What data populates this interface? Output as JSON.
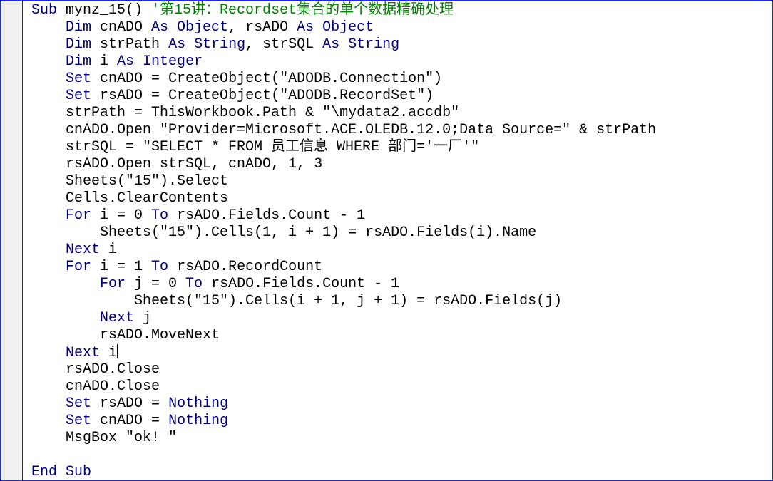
{
  "editor": {
    "colors": {
      "keyword": "#00007f",
      "comment": "#008000",
      "text": "#000000",
      "border": "#1f2bd6"
    },
    "caret_line": 20,
    "lines": [
      [
        [
          "k",
          "Sub"
        ],
        [
          "p",
          " mynz_15() "
        ],
        [
          "c",
          "'第15讲：Recordset集合的单个数据精确处理"
        ]
      ],
      [
        [
          "p",
          "    "
        ],
        [
          "k",
          "Dim"
        ],
        [
          "p",
          " cnADO "
        ],
        [
          "k",
          "As Object"
        ],
        [
          "p",
          ", rsADO "
        ],
        [
          "k",
          "As Object"
        ]
      ],
      [
        [
          "p",
          "    "
        ],
        [
          "k",
          "Dim"
        ],
        [
          "p",
          " strPath "
        ],
        [
          "k",
          "As String"
        ],
        [
          "p",
          ", strSQL "
        ],
        [
          "k",
          "As String"
        ]
      ],
      [
        [
          "p",
          "    "
        ],
        [
          "k",
          "Dim"
        ],
        [
          "p",
          " i "
        ],
        [
          "k",
          "As Integer"
        ]
      ],
      [
        [
          "p",
          "    "
        ],
        [
          "k",
          "Set"
        ],
        [
          "p",
          " cnADO = CreateObject(\"ADODB.Connection\")"
        ]
      ],
      [
        [
          "p",
          "    "
        ],
        [
          "k",
          "Set"
        ],
        [
          "p",
          " rsADO = CreateObject(\"ADODB.RecordSet\")"
        ]
      ],
      [
        [
          "p",
          "    strPath = ThisWorkbook.Path & \"\\mydata2.accdb\""
        ]
      ],
      [
        [
          "p",
          "    cnADO.Open \"Provider=Microsoft.ACE.OLEDB.12.0;Data Source=\" & strPath"
        ]
      ],
      [
        [
          "p",
          "    strSQL = \"SELECT * FROM 员工信息 WHERE 部门='一厂'\""
        ]
      ],
      [
        [
          "p",
          "    rsADO.Open strSQL, cnADO, 1, 3"
        ]
      ],
      [
        [
          "p",
          "    Sheets(\"15\").Select"
        ]
      ],
      [
        [
          "p",
          "    Cells.ClearContents"
        ]
      ],
      [
        [
          "p",
          "    "
        ],
        [
          "k",
          "For"
        ],
        [
          "p",
          " i = 0 "
        ],
        [
          "k",
          "To"
        ],
        [
          "p",
          " rsADO.Fields.Count - 1"
        ]
      ],
      [
        [
          "p",
          "        Sheets(\"15\").Cells(1, i + 1) = rsADO.Fields(i).Name"
        ]
      ],
      [
        [
          "p",
          "    "
        ],
        [
          "k",
          "Next"
        ],
        [
          "p",
          " i"
        ]
      ],
      [
        [
          "p",
          "    "
        ],
        [
          "k",
          "For"
        ],
        [
          "p",
          " i = 1 "
        ],
        [
          "k",
          "To"
        ],
        [
          "p",
          " rsADO.RecordCount"
        ]
      ],
      [
        [
          "p",
          "        "
        ],
        [
          "k",
          "For"
        ],
        [
          "p",
          " j = 0 "
        ],
        [
          "k",
          "To"
        ],
        [
          "p",
          " rsADO.Fields.Count - 1"
        ]
      ],
      [
        [
          "p",
          "            Sheets(\"15\").Cells(i + 1, j + 1) = rsADO.Fields(j)"
        ]
      ],
      [
        [
          "p",
          "        "
        ],
        [
          "k",
          "Next"
        ],
        [
          "p",
          " j"
        ]
      ],
      [
        [
          "p",
          "        rsADO.MoveNext"
        ]
      ],
      [
        [
          "p",
          "    "
        ],
        [
          "k",
          "Next"
        ],
        [
          "p",
          " i"
        ]
      ],
      [
        [
          "p",
          "    rsADO.Close"
        ]
      ],
      [
        [
          "p",
          "    cnADO.Close"
        ]
      ],
      [
        [
          "p",
          "    "
        ],
        [
          "k",
          "Set"
        ],
        [
          "p",
          " rsADO = "
        ],
        [
          "k",
          "Nothing"
        ]
      ],
      [
        [
          "p",
          "    "
        ],
        [
          "k",
          "Set"
        ],
        [
          "p",
          " cnADO = "
        ],
        [
          "k",
          "Nothing"
        ]
      ],
      [
        [
          "p",
          "    MsgBox \"ok! \""
        ]
      ],
      [],
      [
        [
          "k",
          "End Sub"
        ]
      ]
    ]
  }
}
